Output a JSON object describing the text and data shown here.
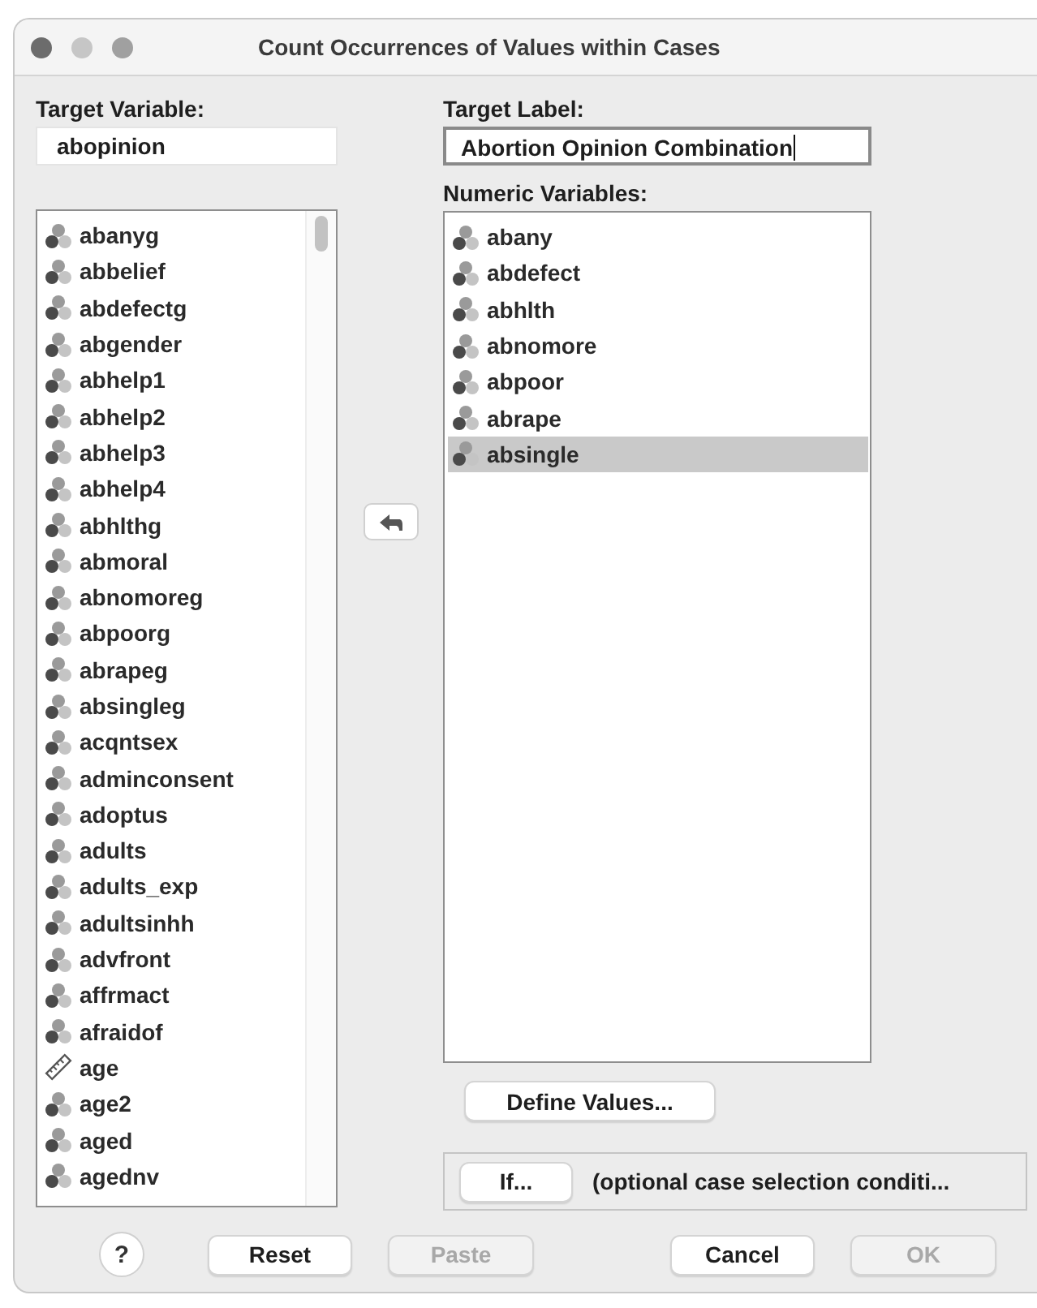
{
  "window": {
    "title": "Count Occurrences of Values within Cases"
  },
  "target_variable": {
    "label": "Target Variable:",
    "value": "abopinion"
  },
  "target_label": {
    "label": "Target Label:",
    "value": "Abortion Opinion Combination"
  },
  "source_variables": [
    {
      "name": "abanyg",
      "kind": "nominal"
    },
    {
      "name": "abbelief",
      "kind": "nominal"
    },
    {
      "name": "abdefectg",
      "kind": "nominal"
    },
    {
      "name": "abgender",
      "kind": "nominal"
    },
    {
      "name": "abhelp1",
      "kind": "nominal"
    },
    {
      "name": "abhelp2",
      "kind": "nominal"
    },
    {
      "name": "abhelp3",
      "kind": "nominal"
    },
    {
      "name": "abhelp4",
      "kind": "nominal"
    },
    {
      "name": "abhlthg",
      "kind": "nominal"
    },
    {
      "name": "abmoral",
      "kind": "nominal"
    },
    {
      "name": "abnomoreg",
      "kind": "nominal"
    },
    {
      "name": "abpoorg",
      "kind": "nominal"
    },
    {
      "name": "abrapeg",
      "kind": "nominal"
    },
    {
      "name": "absingleg",
      "kind": "nominal"
    },
    {
      "name": "acqntsex",
      "kind": "nominal"
    },
    {
      "name": "adminconsent",
      "kind": "nominal"
    },
    {
      "name": "adoptus",
      "kind": "nominal"
    },
    {
      "name": "adults",
      "kind": "nominal"
    },
    {
      "name": "adults_exp",
      "kind": "nominal"
    },
    {
      "name": "adultsinhh",
      "kind": "nominal"
    },
    {
      "name": "advfront",
      "kind": "nominal"
    },
    {
      "name": "affrmact",
      "kind": "nominal"
    },
    {
      "name": "afraidof",
      "kind": "nominal"
    },
    {
      "name": "age",
      "kind": "scale"
    },
    {
      "name": "age2",
      "kind": "nominal"
    },
    {
      "name": "aged",
      "kind": "nominal"
    },
    {
      "name": "agednv",
      "kind": "nominal"
    }
  ],
  "numeric_variables": {
    "label": "Numeric Variables:",
    "items": [
      {
        "name": "abany",
        "kind": "nominal",
        "selected": false
      },
      {
        "name": "abdefect",
        "kind": "nominal",
        "selected": false
      },
      {
        "name": "abhlth",
        "kind": "nominal",
        "selected": false
      },
      {
        "name": "abnomore",
        "kind": "nominal",
        "selected": false
      },
      {
        "name": "abpoor",
        "kind": "nominal",
        "selected": false
      },
      {
        "name": "abrape",
        "kind": "nominal",
        "selected": false
      },
      {
        "name": "absingle",
        "kind": "nominal",
        "selected": true
      }
    ]
  },
  "define_values_button": "Define Values...",
  "if_button": "If...",
  "if_condition": "(optional case selection conditi...",
  "buttons": [
    {
      "label": "?",
      "kind": "help",
      "disabled": false
    },
    {
      "label": "Reset",
      "kind": "push",
      "disabled": false
    },
    {
      "label": "Paste",
      "kind": "push",
      "disabled": true
    },
    {
      "label": "Cancel",
      "kind": "push",
      "disabled": false
    },
    {
      "label": "OK",
      "kind": "push",
      "disabled": true
    }
  ]
}
